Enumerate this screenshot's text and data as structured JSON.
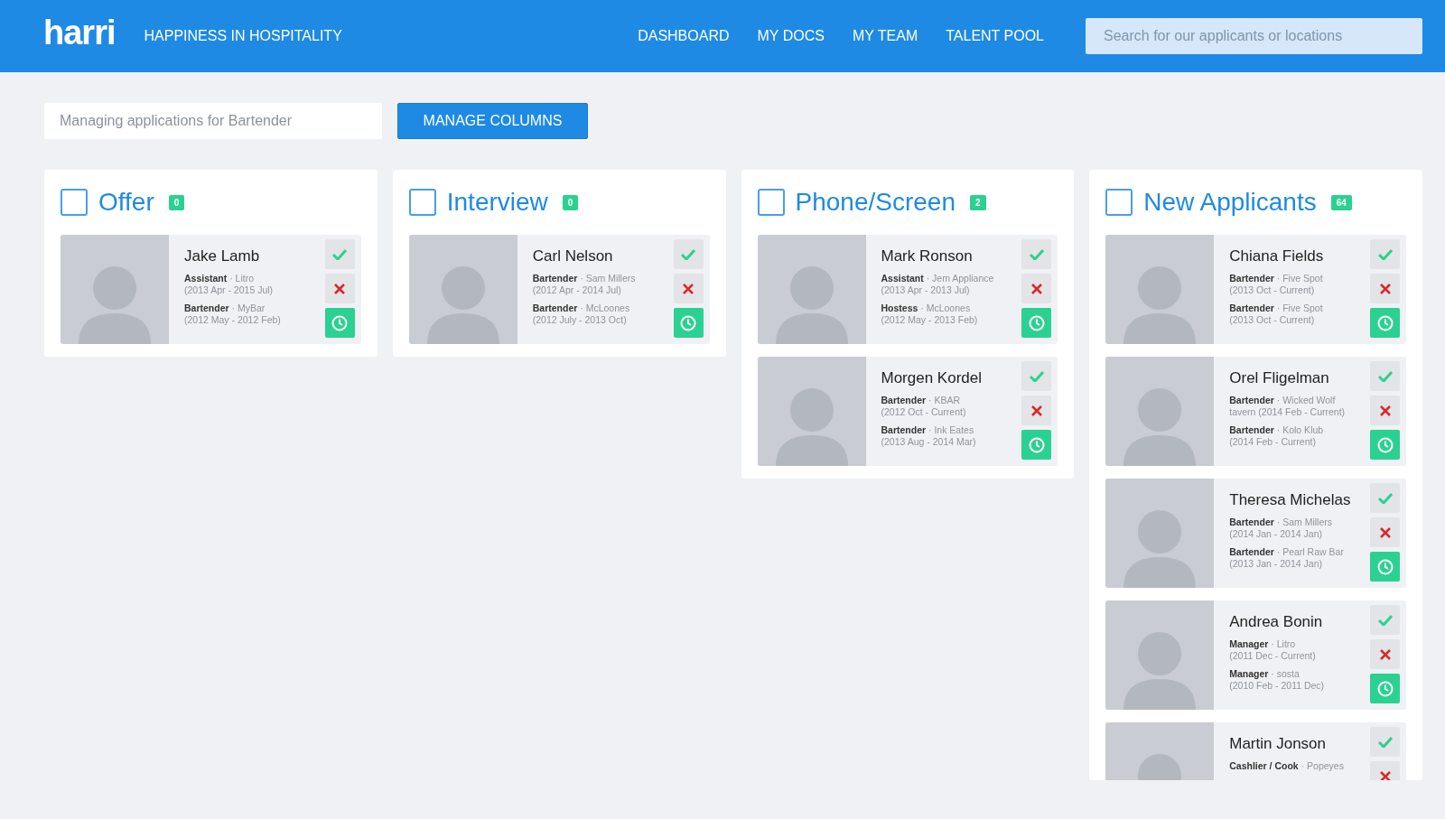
{
  "header": {
    "logo": "harri",
    "tagline": "HAPPINESS IN HOSPITALITY",
    "nav": [
      {
        "label": "DASHBOARD"
      },
      {
        "label": "MY DOCS"
      },
      {
        "label": "MY TEAM"
      },
      {
        "label": "TALENT POOL"
      }
    ],
    "search": {
      "placeholder": "Search for our applicants or locations"
    }
  },
  "toolbar": {
    "field": {
      "placeholder": "Managing applications for Bartender"
    },
    "button": "MANAGE COLUMNS"
  },
  "columns": [
    {
      "title": "Offer",
      "count": "0",
      "checked": false,
      "applicants": [
        {
          "name": "Jake Lamb",
          "jobs": [
            [
              "**Assistant** · Litro",
              "(2013 Apr - 2015 Jul)"
            ],
            [
              "**Bartender** · MyBar",
              "(2012 May - 2012 Feb)"
            ]
          ]
        }
      ]
    },
    {
      "title": "Interview",
      "count": "0",
      "checked": false,
      "applicants": [
        {
          "name": "Carl Nelson",
          "jobs": [
            [
              "**Bartender** · Sam Millers",
              "(2012 Apr - 2014 Jul)"
            ],
            [
              "**Bartender** · McLoones",
              "(2012 July - 2013 Oct)"
            ]
          ]
        }
      ]
    },
    {
      "title": "Phone/Screen",
      "count": "2",
      "checked": false,
      "applicants": [
        {
          "name": "Mark Ronson",
          "jobs": [
            [
              "**Assistant** · Jem Appliance",
              "(2013 Apr - 2013 Jul)"
            ],
            [
              "**Hostess** · McLoones",
              "(2012 May - 2013 Feb)"
            ]
          ]
        },
        {
          "name": "Morgen Kordel",
          "jobs": [
            [
              "**Bartender** · KBAR",
              "(2012 Oct - Current)"
            ],
            [
              "**Bartender** · Ink Eates",
              "(2013 Aug - 2014 Mar)"
            ]
          ]
        }
      ]
    },
    {
      "title": "New Applicants",
      "count": "64",
      "checked": false,
      "applicants": [
        {
          "name": "Chiana Fields",
          "jobs": [
            [
              "**Bartender** · Five Spot",
              "(2013 Oct - Current)"
            ],
            [
              "**Bartender** · Five Spot",
              "(2013 Oct - Current)"
            ]
          ]
        },
        {
          "name": "Orel Fligelman",
          "jobs": [
            [
              "**Bartender** · Wicked Wolf",
              "tavern (2014 Feb - Current)"
            ],
            [
              "**Bartender** · Kolo Klub",
              "(2014 Feb - Current)"
            ]
          ]
        },
        {
          "name": "Theresa Michelas",
          "jobs": [
            [
              "**Bartender** · Sam Millers",
              "(2014 Jan - 2014 Jan)"
            ],
            [
              "**Bartender** · Pearl Raw Bar",
              "(2013 Jan - 2014 Jan)"
            ]
          ]
        },
        {
          "name": "Andrea Bonin",
          "jobs": [
            [
              "**Manager** · Litro",
              "(2011 Dec - Current)"
            ],
            [
              "**Manager** · sosta",
              "(2010 Feb - 2011 Dec)"
            ]
          ]
        },
        {
          "name": "Martin Jonson",
          "jobs": [
            [
              "**Cashlier / Cook** · Popeyes"
            ]
          ]
        }
      ]
    }
  ]
}
